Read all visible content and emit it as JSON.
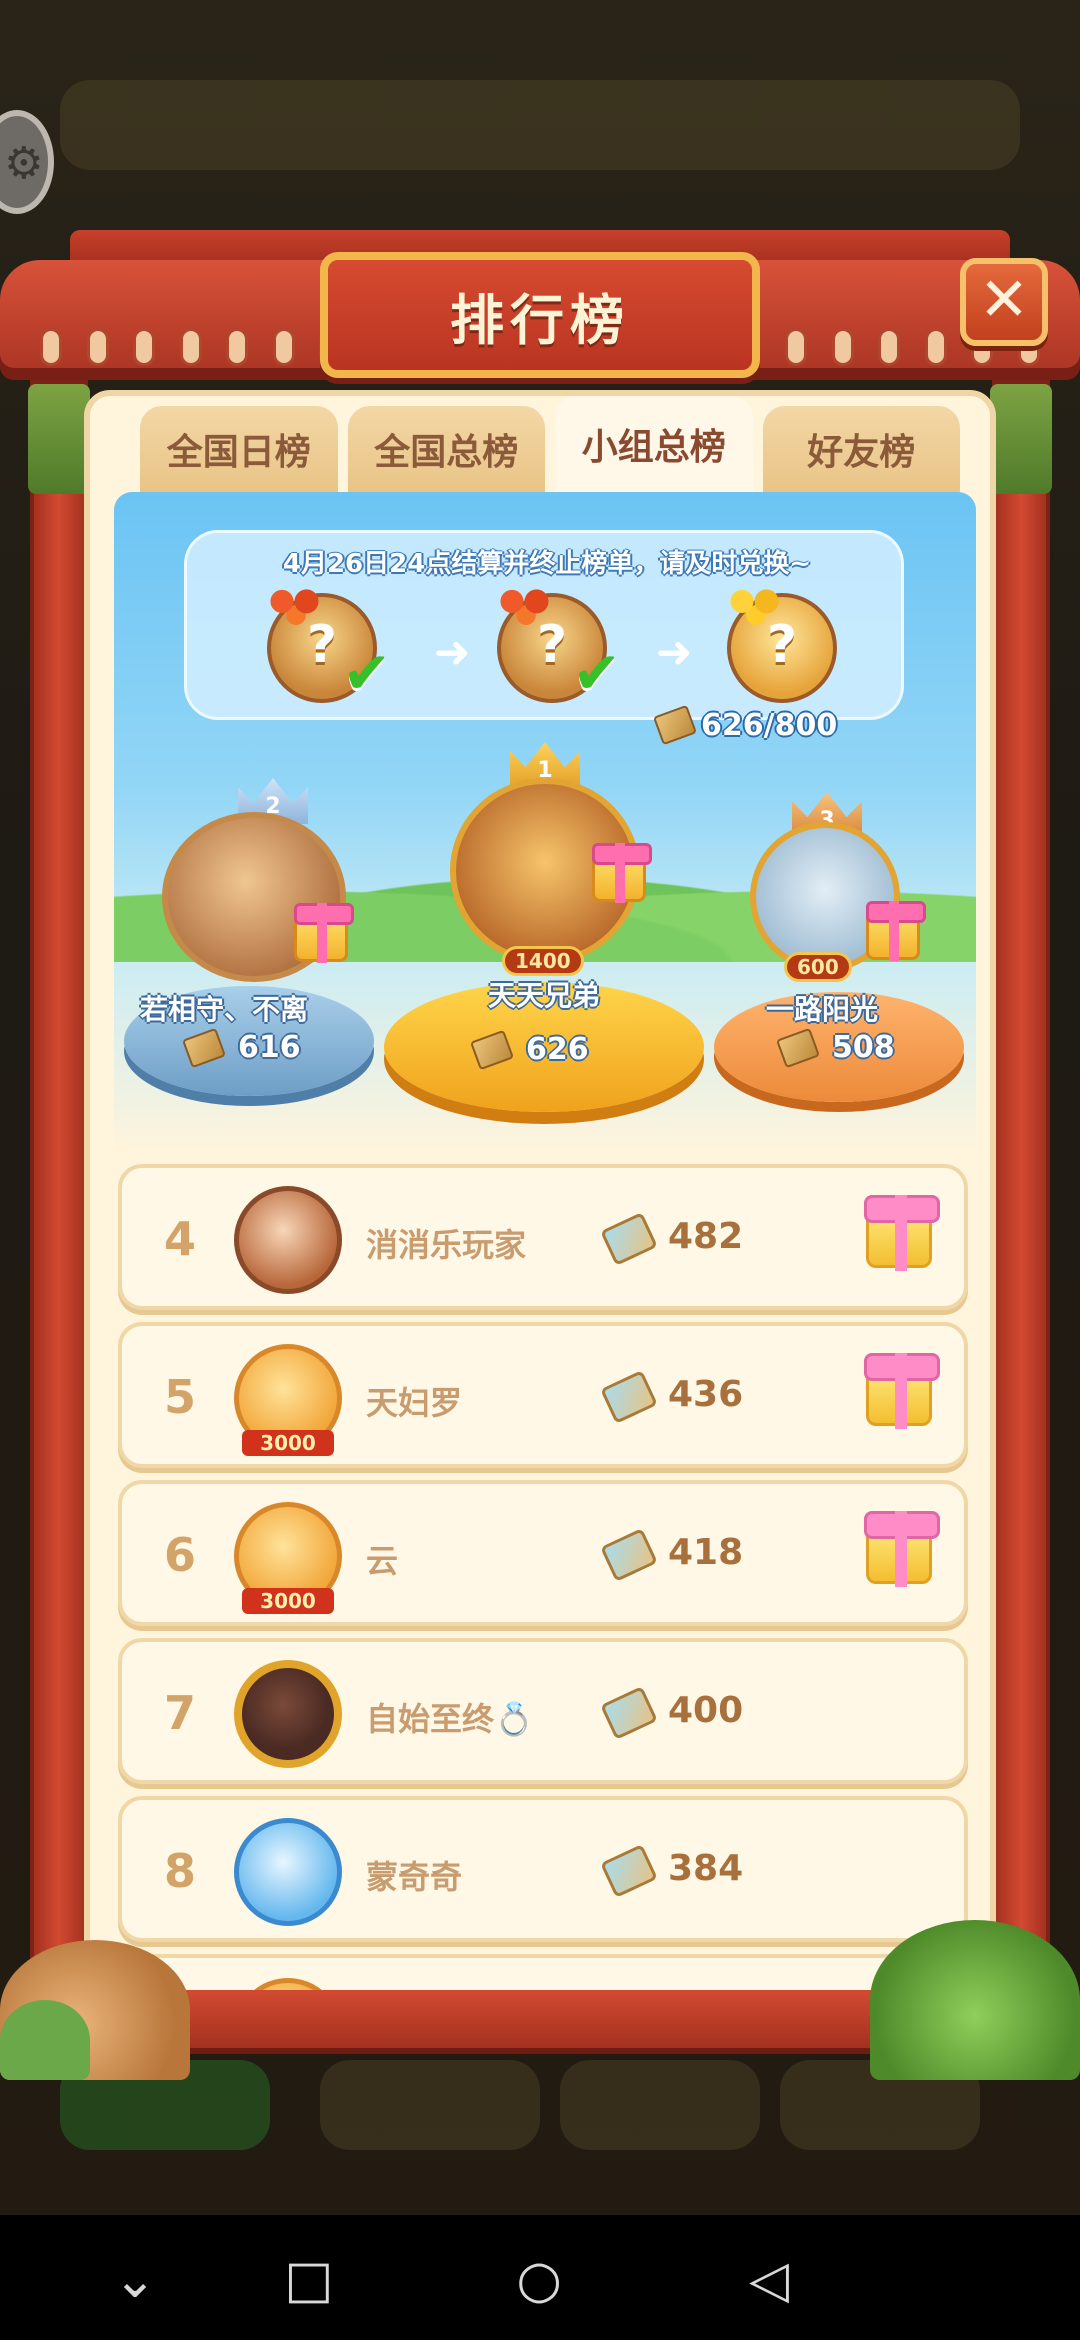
{
  "header": {
    "title": "排行榜",
    "close_glyph": "✕"
  },
  "tabs": [
    {
      "label": "全国日榜",
      "active": false
    },
    {
      "label": "全国总榜",
      "active": false
    },
    {
      "label": "小组总榜",
      "active": true
    },
    {
      "label": "好友榜",
      "active": false
    }
  ],
  "banner": {
    "notice": "4月26日24点结算并终止榜单，请及时兑换~",
    "progress_text": "626/800",
    "progress_current": 626,
    "progress_total": 800,
    "stage_glyph": "?",
    "check_glyph": "✔",
    "arrow_glyph": "➜"
  },
  "podium": {
    "first": {
      "rank": "1",
      "name": "天天兄弟",
      "score": "626",
      "badge": "1400"
    },
    "second": {
      "rank": "2",
      "name": "若相守、不离",
      "score": "616"
    },
    "third": {
      "rank": "3",
      "name": "一路阳光",
      "score": "508",
      "badge": "600"
    }
  },
  "list": [
    {
      "rank": "4",
      "name": "消消乐玩家",
      "score": "482",
      "gift": true
    },
    {
      "rank": "5",
      "name": "天妇罗",
      "score": "436",
      "gift": true,
      "tag": "3000"
    },
    {
      "rank": "6",
      "name": "云",
      "score": "418",
      "gift": true,
      "tag": "3000"
    },
    {
      "rank": "7",
      "name": "自始至终💍",
      "score": "400",
      "gift": false
    },
    {
      "rank": "8",
      "name": "蒙奇奇",
      "score": "384",
      "gift": false
    }
  ],
  "navbar": {
    "back_glyph": "◁",
    "home_glyph": "○",
    "recents_glyph": "□",
    "down_glyph": "⌄"
  },
  "colors": {
    "frame_red": "#c6402a",
    "panel_cream": "#fff4dc",
    "rank_text": "#d2a46a",
    "score_text": "#a8703c"
  }
}
